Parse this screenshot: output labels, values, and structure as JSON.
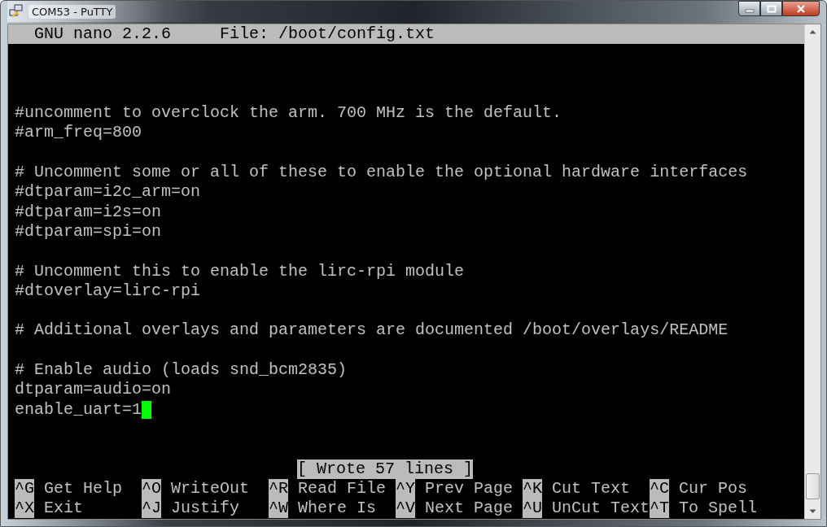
{
  "window": {
    "title": "COM53 - PuTTY"
  },
  "header": {
    "program": "GNU nano 2.2.6",
    "file": "File: /boot/config.txt"
  },
  "lines": [
    {
      "cursor": false
    },
    {
      "cursor": false
    },
    {
      "cursor": false
    },
    {
      "text": "#uncomment to overclock the arm. 700 MHz is the default.",
      "cursor": false
    },
    {
      "text": "#arm_freq=800",
      "cursor": false
    },
    {
      "cursor": false
    },
    {
      "text": "# Uncomment some or all of these to enable the optional hardware interfaces",
      "cursor": false
    },
    {
      "text": "#dtparam=i2c_arm=on",
      "cursor": false
    },
    {
      "text": "#dtparam=i2s=on",
      "cursor": false
    },
    {
      "text": "#dtparam=spi=on",
      "cursor": false
    },
    {
      "cursor": false
    },
    {
      "text": "# Uncomment this to enable the lirc-rpi module",
      "cursor": false
    },
    {
      "text": "#dtoverlay=lirc-rpi",
      "cursor": false
    },
    {
      "cursor": false
    },
    {
      "text": "# Additional overlays and parameters are documented /boot/overlays/README",
      "cursor": false
    },
    {
      "cursor": false
    },
    {
      "text": "# Enable audio (loads snd_bcm2835)",
      "cursor": false
    },
    {
      "text": "dtparam=audio=on",
      "cursor": false
    },
    {
      "text": "enable_uart=1",
      "cursor": true
    },
    {
      "cursor": false
    },
    {
      "cursor": false
    }
  ],
  "status": "[ Wrote 57 lines ]",
  "shortcuts": [
    [
      {
        "key": "^G",
        "label": "Get Help"
      },
      {
        "key": "^O",
        "label": "WriteOut"
      },
      {
        "key": "^R",
        "label": "Read File"
      },
      {
        "key": "^Y",
        "label": "Prev Page"
      },
      {
        "key": "^K",
        "label": "Cut Text"
      },
      {
        "key": "^C",
        "label": "Cur Pos"
      }
    ],
    [
      {
        "key": "^X",
        "label": "Exit"
      },
      {
        "key": "^J",
        "label": "Justify"
      },
      {
        "key": "^W",
        "label": "Where Is"
      },
      {
        "key": "^V",
        "label": "Next Page"
      },
      {
        "key": "^U",
        "label": "UnCut Text"
      },
      {
        "key": "^T",
        "label": "To Spell"
      }
    ]
  ]
}
